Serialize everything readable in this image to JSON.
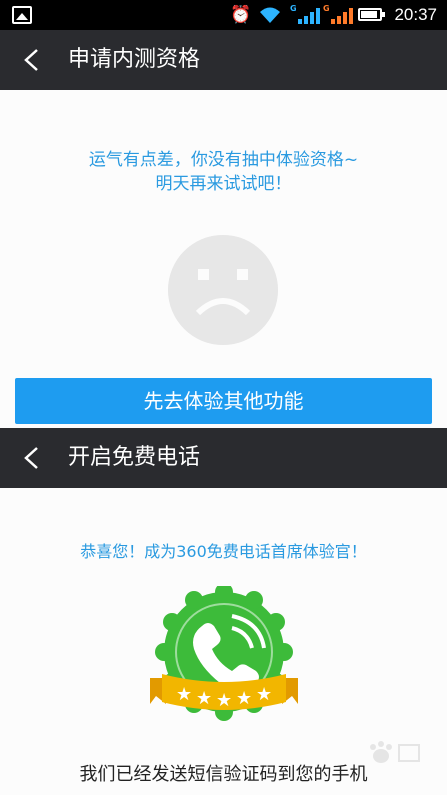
{
  "status_bar": {
    "time": "20:37",
    "icons": [
      "picture-icon",
      "alarm-icon",
      "wifi-icon",
      "signal-icon",
      "battery-icon"
    ],
    "network_label": "G"
  },
  "screen1": {
    "title": "申请内测资格",
    "message_line1": "运气有点差，你没有抽中体验资格~",
    "message_line2": "明天再来试试吧！",
    "button_label": "先去体验其他功能"
  },
  "screen2": {
    "title": "开启免费电话",
    "congrats": "恭喜您！成为360免费电话首席体验官！",
    "sms_notice": "我们已经发送短信验证码到您的手机"
  },
  "colors": {
    "accent": "#1e9cf0",
    "title_bar": "#2a2b2f",
    "badge_green": "#3dbb3a",
    "ribbon_gold": "#f2b600"
  }
}
